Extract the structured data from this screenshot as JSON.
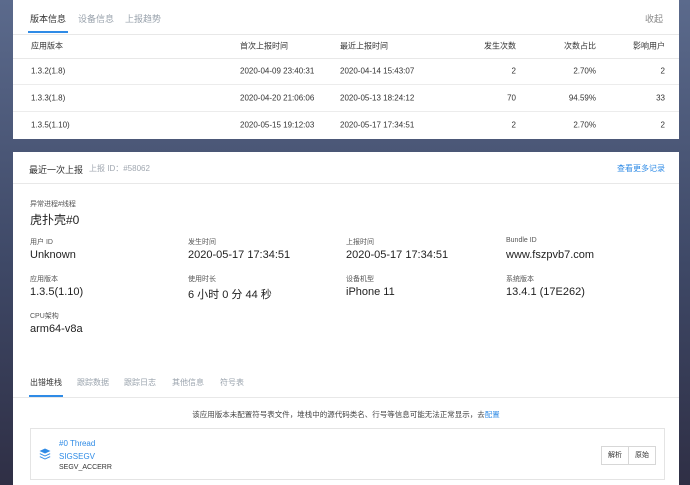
{
  "top_tabs": [
    "版本信息",
    "设备信息",
    "上报趋势"
  ],
  "collapse_label": "收起",
  "version_table": {
    "headers": [
      "应用版本",
      "首次上报时间",
      "最近上报时间",
      "发生次数",
      "次数占比",
      "影响用户"
    ],
    "rows": [
      [
        "1.3.2(1.8)",
        "2020-04-09 23:40:31",
        "2020-04-14 15:43:07",
        "2",
        "2.70%",
        "2"
      ],
      [
        "1.3.3(1.8)",
        "2020-04-20 21:06:06",
        "2020-05-13 18:24:12",
        "70",
        "94.59%",
        "33"
      ],
      [
        "1.3.5(1.10)",
        "2020-05-15 19:12:03",
        "2020-05-17 17:34:51",
        "2",
        "2.70%",
        "2"
      ]
    ]
  },
  "latest": {
    "title": "最近一次上报",
    "report_id": "上报 ID：#58062",
    "more_link": "查看更多记录",
    "exception_label": "异常进程#线程",
    "exception_value": "虎扑壳#0",
    "fields": [
      {
        "label": "用户 ID",
        "value": "Unknown"
      },
      {
        "label": "发生时间",
        "value": "2020-05-17 17:34:51"
      },
      {
        "label": "上报时间",
        "value": "2020-05-17 17:34:51"
      },
      {
        "label": "Bundle ID",
        "value": "www.fszpvb7.com"
      },
      {
        "label": "应用版本",
        "value": "1.3.5(1.10)"
      },
      {
        "label": "使用时长",
        "value": "6 小时 0 分 44 秒"
      },
      {
        "label": "设备机型",
        "value": "iPhone 11"
      },
      {
        "label": "系统版本",
        "value": "13.4.1 (17E262)"
      },
      {
        "label": "CPU架构",
        "value": "arm64-v8a"
      }
    ]
  },
  "detail_tabs": [
    "出错堆栈",
    "跟踪数据",
    "跟踪日志",
    "其他信息",
    "符号表"
  ],
  "notice": {
    "text": "该应用版本未配置符号表文件，堆栈中的源代码类名、行号等信息可能无法正常显示，去",
    "link": "配置"
  },
  "thread": {
    "name": "#0 Thread",
    "signal": "SIGSEGV",
    "code": "SEGV_ACCERR",
    "parse_button": "解析",
    "raw_button": "原始"
  },
  "colors": {
    "accent": "#2f8be6"
  }
}
